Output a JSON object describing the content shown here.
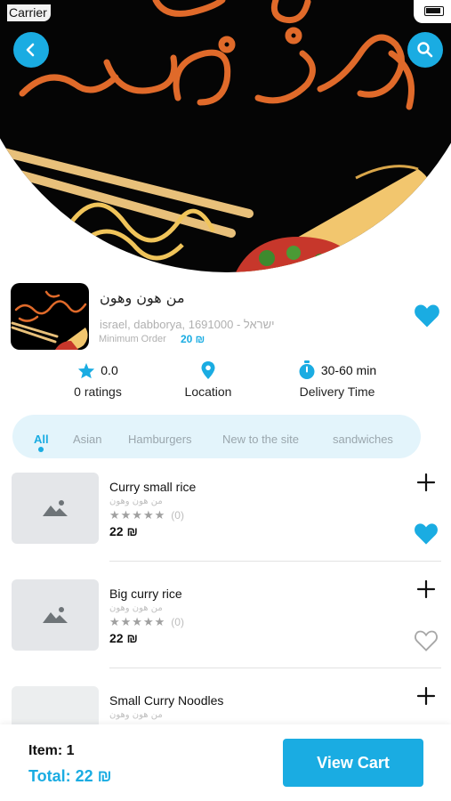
{
  "status_bar": {
    "carrier": "Carrier"
  },
  "restaurant": {
    "name": "من هون وهون",
    "address": "israel, dabborya,  1691000 - ישראל",
    "min_order_label": "Minimum Order",
    "min_order_value": "20 ₪",
    "favorited": true
  },
  "stats": {
    "rating_value": "0.0",
    "rating_label": "0 ratings",
    "location_label": "Location",
    "delivery_value": "30-60 min",
    "delivery_label": "Delivery Time"
  },
  "categories": [
    "All",
    "Asian",
    "Hamburgers",
    "New to the site",
    "sandwiches"
  ],
  "active_category": "All",
  "menu": [
    {
      "title": "Curry small rice",
      "restaurant": "من هون وهون",
      "rating_count": "(0)",
      "price": "22 ₪",
      "favorited": true
    },
    {
      "title": "Big curry rice",
      "restaurant": "من هون وهون",
      "rating_count": "(0)",
      "price": "22 ₪",
      "favorited": false
    },
    {
      "title": "Small Curry Noodles",
      "restaurant": "من هون وهون",
      "rating_count": "",
      "price": "",
      "favorited": false
    }
  ],
  "cart": {
    "items_label": "Item: 1",
    "total_label": "Total: 22 ₪",
    "button_label": "View Cart"
  },
  "colors": {
    "accent": "#1aace2",
    "category_bg": "#e3f4fb",
    "placeholder": "#e4e6e9"
  },
  "icons": [
    "back-arrow-icon",
    "search-icon",
    "heart-icon",
    "star-icon",
    "location-pin-icon",
    "stopwatch-icon",
    "image-placeholder-icon",
    "plus-icon"
  ]
}
